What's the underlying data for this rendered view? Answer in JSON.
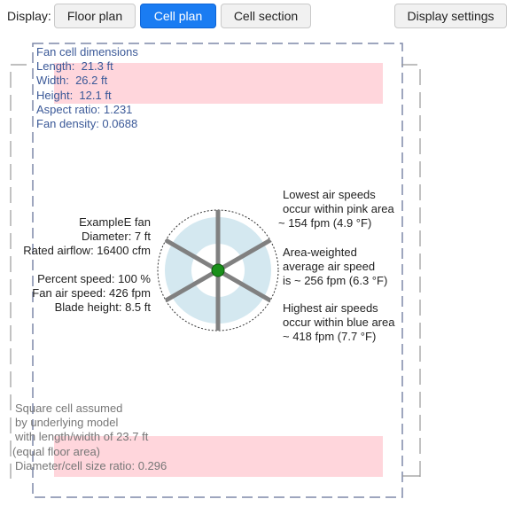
{
  "toolbar": {
    "display_label": "Display:",
    "buttons": {
      "floor_plan": "Floor plan",
      "cell_plan": "Cell plan",
      "cell_section": "Cell section",
      "display_settings": "Display settings"
    },
    "active": "Cell plan"
  },
  "cell_dimensions": {
    "heading": "Fan cell dimensions",
    "length": "Length:  21.3 ft",
    "width": "Width:  26.2 ft",
    "height": "Height:  12.1 ft",
    "aspect_ratio": "Aspect ratio: 1.231",
    "fan_density": "Fan density: 0.0688"
  },
  "fan": {
    "name": "ExampleE fan",
    "diameter": "Diameter: 7 ft",
    "rated_airflow": "Rated airflow: 16400 cfm",
    "percent_speed": "Percent speed: 100 %",
    "fan_air_speed": "Fan air speed: 426 fpm",
    "blade_height": "Blade height: 8.5 ft"
  },
  "air_speeds": {
    "lowest_1": "Lowest air speeds",
    "lowest_2": "occur within pink area",
    "lowest_3": "~ 154 fpm (4.9 °F)",
    "average_1": "Area-weighted",
    "average_2": "average air speed",
    "average_3": "is ~ 256 fpm (6.3 °F)",
    "highest_1": "Highest air speeds",
    "highest_2": "occur within blue area",
    "highest_3": "~ 418 fpm (7.7 °F)"
  },
  "square_cell": {
    "line1": "Square cell assumed",
    "line2": "by underlying model",
    "line3": "with length/width of 23.7 ft",
    "line4": "(equal floor area)",
    "line5": "Diameter/cell size ratio: 0.296"
  },
  "colors": {
    "active_button": "#1a7cf2",
    "pink_zone": "#ffd6dc",
    "blue_zone": "#d4e8f0",
    "dimension_text": "#3b5998",
    "dash_line": "#7f89a8",
    "hub": "#1a8f1a",
    "blade": "#808080"
  },
  "icons": {
    "fan": "ceiling-fan-icon"
  }
}
